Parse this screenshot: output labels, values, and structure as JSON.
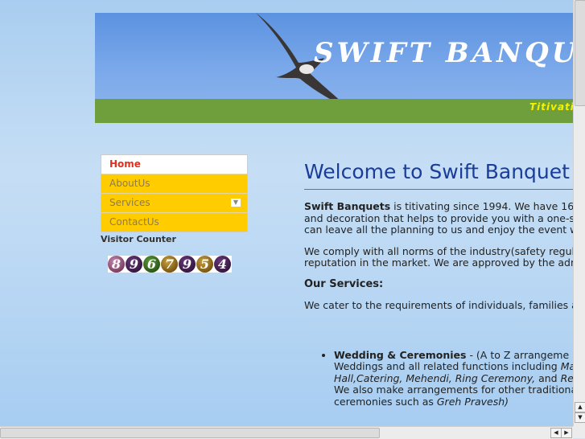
{
  "banner": {
    "title": "SWIFT BANQUET",
    "tagline": "Titivati"
  },
  "menu": {
    "items": [
      {
        "label": "Home"
      },
      {
        "label": "AboutUs"
      },
      {
        "label": "Services"
      },
      {
        "label": "ContactUs"
      }
    ],
    "active_color": "#e0301e",
    "bg_color": "#ffcc00"
  },
  "visitor_counter": {
    "label": "Visitor Counter",
    "digits": [
      "8",
      "9",
      "6",
      "7",
      "9",
      "5",
      "4"
    ]
  },
  "main": {
    "heading": "Welcome to Swift Banquet",
    "p1": {
      "bold": "Swift Banquets",
      "line1": " is titivating since 1994. We have 16",
      "line2": "and decoration that helps to provide you with a one-s",
      "line3": "can leave all the planning to us and enjoy the event w"
    },
    "p2": {
      "line1": "We comply with all norms of the industry(safety regula",
      "line2": "reputation in the market. We are approved by the adm"
    },
    "services_heading": "Our Services:",
    "p3": "We cater to the requirements of individuals, families ar",
    "services": [
      {
        "title": "Wedding & Ceremonies",
        "line1": " - (A to Z arrangeme",
        "line2a": "Weddings and all related functions including ",
        "line2b": "Ma",
        "line3a": "Hall,Catering, Mehendi, Ring Ceremony,",
        "line3b": " and ",
        "line3c": "Re",
        "line4": "We also make arrangements for other traditiona",
        "line5a": "ceremonies such as ",
        "line5b": "Greh Pravesh)"
      }
    ]
  }
}
